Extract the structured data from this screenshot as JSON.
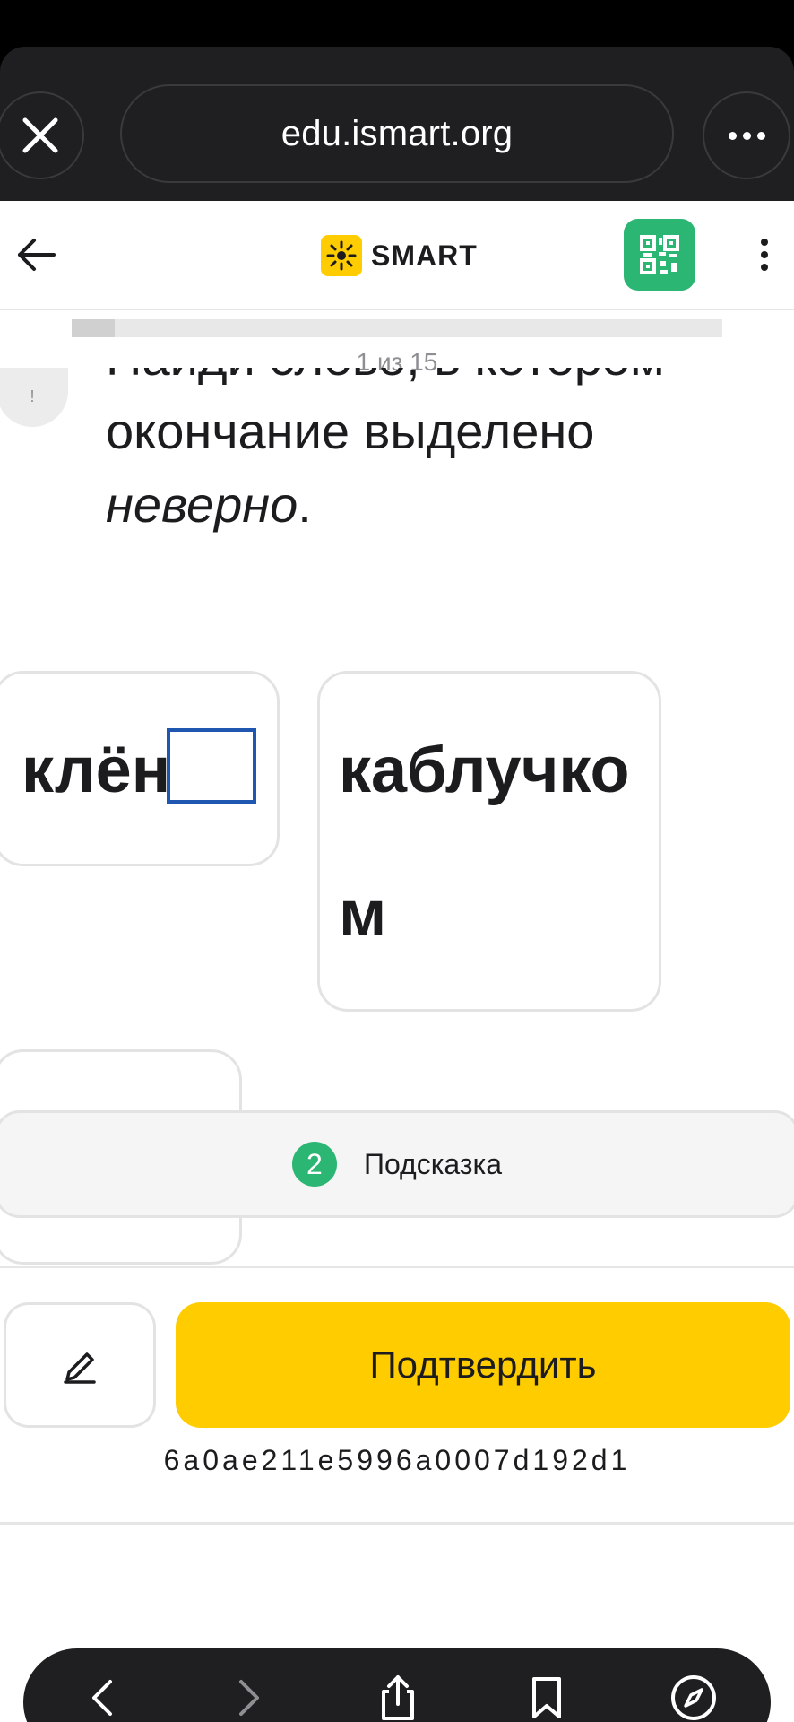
{
  "browser": {
    "url": "edu.ismart.org"
  },
  "header": {
    "logo_text": "SMART"
  },
  "progress": {
    "fraction": 0.0667,
    "counter": "1 из 15"
  },
  "question": {
    "badge": "!",
    "line1": "Найди слово, в котором",
    "line2": "окончание выделено",
    "line3_em": "неверно",
    "line3_tail": "."
  },
  "answers": [
    {
      "word": "клён"
    },
    {
      "word_line1": "каблучко",
      "word_line2": "м"
    }
  ],
  "hint": {
    "count": "2",
    "label": "Подсказка"
  },
  "actions": {
    "confirm_label": "Подтвердить",
    "task_id": "6a0ae211e5996a0007d192d1"
  },
  "colors": {
    "accent_yellow": "#ffcc00",
    "accent_green": "#2bb673",
    "selection_blue": "#1f56b0",
    "browser_chrome": "#1f1f21"
  },
  "icons": {
    "close": "close-icon",
    "more": "more-icon",
    "back": "arrow-left-icon",
    "logo": "sun-logo-icon",
    "qr": "qr-code-icon",
    "menu": "kebab-menu-icon",
    "edit": "pencil-icon",
    "nav_back": "chevron-left-icon",
    "nav_forward": "chevron-right-icon",
    "share": "share-icon",
    "bookmarks": "bookmark-icon",
    "safari": "compass-icon"
  }
}
